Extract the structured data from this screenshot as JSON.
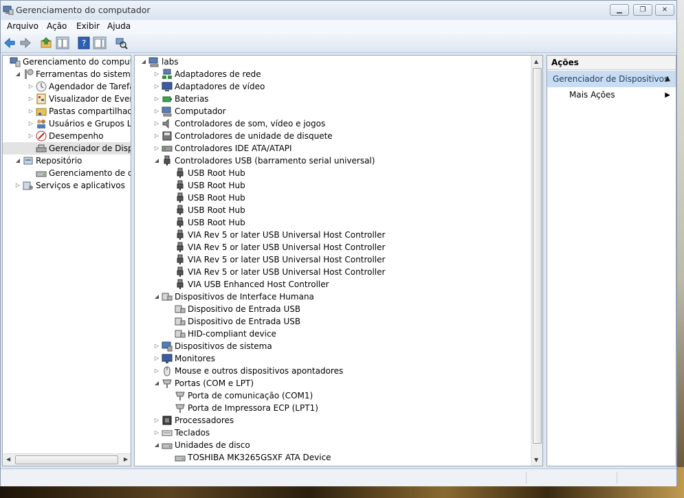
{
  "window": {
    "title": "Gerenciamento do computador"
  },
  "menu": [
    "Arquivo",
    "Ação",
    "Exibir",
    "Ajuda"
  ],
  "left_tree": [
    {
      "label": "Gerenciamento do computado",
      "level": 0,
      "exp": "",
      "icon": "computer-management-icon"
    },
    {
      "label": "Ferramentas do sistema",
      "level": 1,
      "exp": "open",
      "icon": "system-tools-icon"
    },
    {
      "label": "Agendador de Tarefas",
      "level": 2,
      "exp": "closed",
      "icon": "clock-icon"
    },
    {
      "label": "Visualizador de Eventos",
      "level": 2,
      "exp": "closed",
      "icon": "event-viewer-icon"
    },
    {
      "label": "Pastas compartilhadas",
      "level": 2,
      "exp": "closed",
      "icon": "shared-folder-icon"
    },
    {
      "label": "Usuários e Grupos Loca",
      "level": 2,
      "exp": "closed",
      "icon": "users-icon"
    },
    {
      "label": "Desempenho",
      "level": 2,
      "exp": "closed",
      "icon": "performance-icon"
    },
    {
      "label": "Gerenciador de Disposit",
      "level": 2,
      "exp": "",
      "icon": "device-manager-icon",
      "selected": true
    },
    {
      "label": "Repositório",
      "level": 1,
      "exp": "open",
      "icon": "storage-icon"
    },
    {
      "label": "Gerenciamento de disco",
      "level": 2,
      "exp": "",
      "icon": "disk-management-icon"
    },
    {
      "label": "Serviços e aplicativos",
      "level": 1,
      "exp": "closed",
      "icon": "services-icon"
    }
  ],
  "device_tree": [
    {
      "label": "labs",
      "level": 0,
      "exp": "open",
      "icon": "computer-icon"
    },
    {
      "label": "Adaptadores de rede",
      "level": 1,
      "exp": "closed",
      "icon": "network-adapter-icon"
    },
    {
      "label": "Adaptadores de vídeo",
      "level": 1,
      "exp": "closed",
      "icon": "display-adapter-icon"
    },
    {
      "label": "Baterias",
      "level": 1,
      "exp": "closed",
      "icon": "battery-icon"
    },
    {
      "label": "Computador",
      "level": 1,
      "exp": "closed",
      "icon": "computer-icon"
    },
    {
      "label": "Controladores de som, vídeo e jogos",
      "level": 1,
      "exp": "closed",
      "icon": "speaker-icon"
    },
    {
      "label": "Controladores de unidade de disquete",
      "level": 1,
      "exp": "closed",
      "icon": "floppy-controller-icon"
    },
    {
      "label": "Controladores IDE ATA/ATAPI",
      "level": 1,
      "exp": "closed",
      "icon": "ide-controller-icon"
    },
    {
      "label": "Controladores USB (barramento serial universal)",
      "level": 1,
      "exp": "open",
      "icon": "usb-icon"
    },
    {
      "label": "USB Root Hub",
      "level": 2,
      "exp": "",
      "icon": "usb-icon"
    },
    {
      "label": "USB Root Hub",
      "level": 2,
      "exp": "",
      "icon": "usb-icon"
    },
    {
      "label": "USB Root Hub",
      "level": 2,
      "exp": "",
      "icon": "usb-icon"
    },
    {
      "label": "USB Root Hub",
      "level": 2,
      "exp": "",
      "icon": "usb-icon"
    },
    {
      "label": "USB Root Hub",
      "level": 2,
      "exp": "",
      "icon": "usb-icon"
    },
    {
      "label": "VIA Rev 5 or later USB Universal Host Controller",
      "level": 2,
      "exp": "",
      "icon": "usb-icon"
    },
    {
      "label": "VIA Rev 5 or later USB Universal Host Controller",
      "level": 2,
      "exp": "",
      "icon": "usb-icon"
    },
    {
      "label": "VIA Rev 5 or later USB Universal Host Controller",
      "level": 2,
      "exp": "",
      "icon": "usb-icon"
    },
    {
      "label": "VIA Rev 5 or later USB Universal Host Controller",
      "level": 2,
      "exp": "",
      "icon": "usb-icon"
    },
    {
      "label": "VIA USB Enhanced Host Controller",
      "level": 2,
      "exp": "",
      "icon": "usb-icon"
    },
    {
      "label": "Dispositivos de Interface Humana",
      "level": 1,
      "exp": "open",
      "icon": "hid-icon"
    },
    {
      "label": "Dispositivo de Entrada USB",
      "level": 2,
      "exp": "",
      "icon": "hid-icon"
    },
    {
      "label": "Dispositivo de Entrada USB",
      "level": 2,
      "exp": "",
      "icon": "hid-icon"
    },
    {
      "label": "HID-compliant device",
      "level": 2,
      "exp": "",
      "icon": "hid-icon"
    },
    {
      "label": "Dispositivos de sistema",
      "level": 1,
      "exp": "closed",
      "icon": "system-device-icon"
    },
    {
      "label": "Monitores",
      "level": 1,
      "exp": "closed",
      "icon": "monitor-icon"
    },
    {
      "label": "Mouse e outros dispositivos apontadores",
      "level": 1,
      "exp": "closed",
      "icon": "mouse-icon"
    },
    {
      "label": "Portas (COM e LPT)",
      "level": 1,
      "exp": "open",
      "icon": "port-icon"
    },
    {
      "label": "Porta de comunicação (COM1)",
      "level": 2,
      "exp": "",
      "icon": "port-icon"
    },
    {
      "label": "Porta de Impressora ECP (LPT1)",
      "level": 2,
      "exp": "",
      "icon": "port-icon"
    },
    {
      "label": "Processadores",
      "level": 1,
      "exp": "closed",
      "icon": "processor-icon"
    },
    {
      "label": "Teclados",
      "level": 1,
      "exp": "closed",
      "icon": "keyboard-icon"
    },
    {
      "label": "Unidades de disco",
      "level": 1,
      "exp": "open",
      "icon": "disk-drive-icon"
    },
    {
      "label": "TOSHIBA MK3265GSXF ATA Device",
      "level": 2,
      "exp": "",
      "icon": "disk-drive-icon"
    }
  ],
  "actions": {
    "header": "Ações",
    "section": "Gerenciador de Dispositivos",
    "item": "Mais Ações"
  }
}
